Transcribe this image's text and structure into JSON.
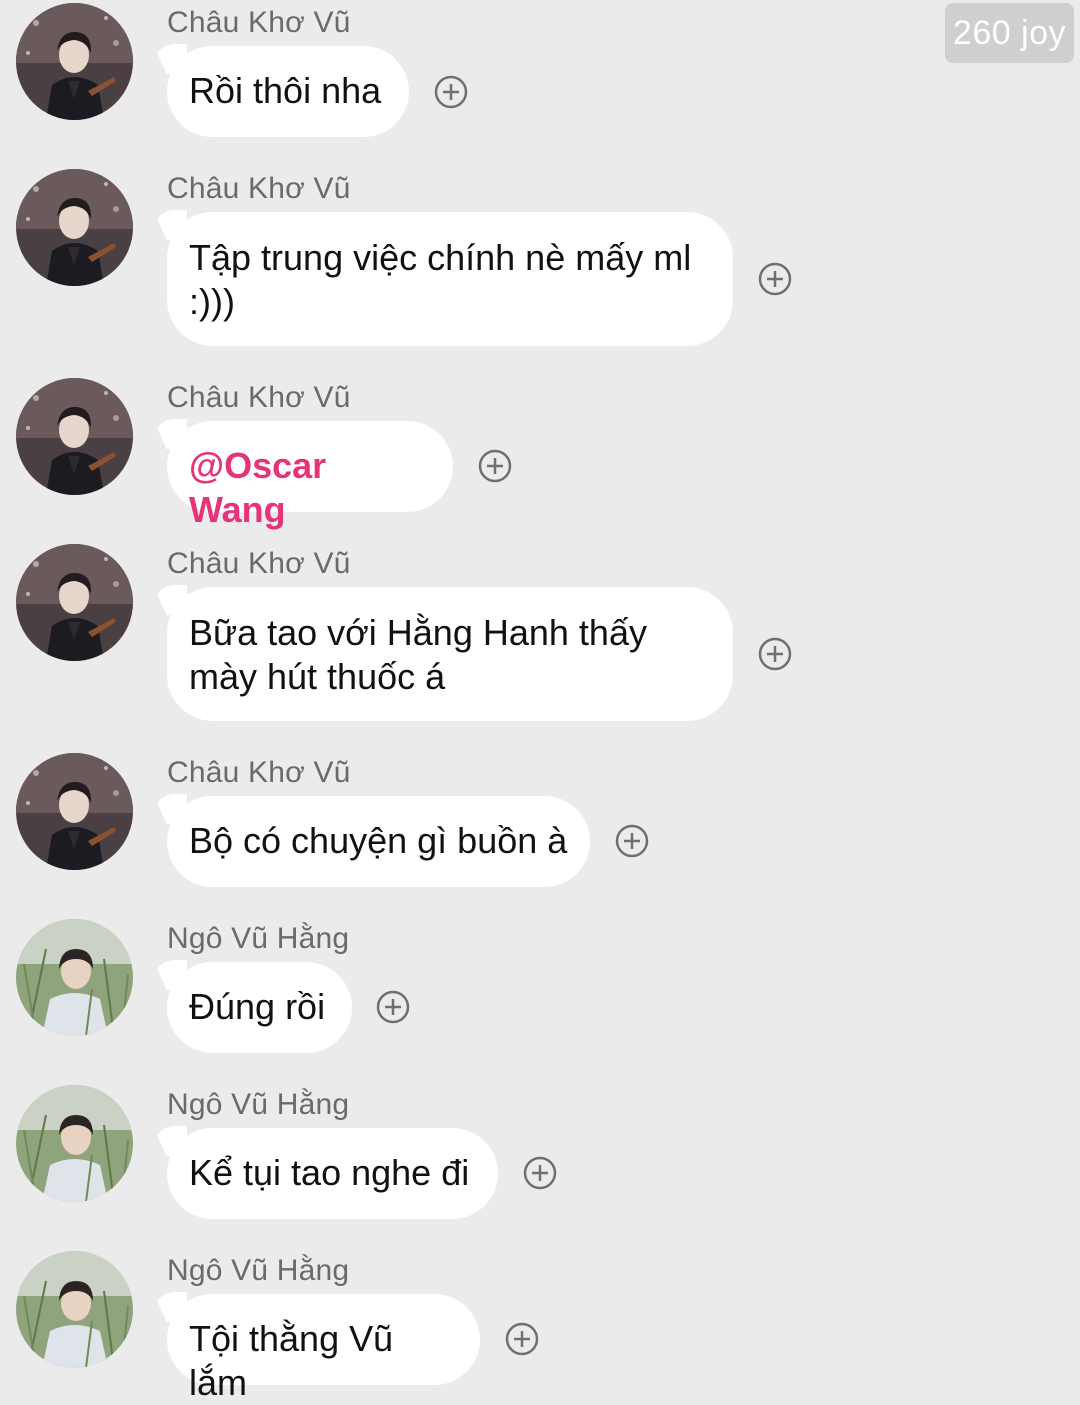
{
  "badge": {
    "label": "260 joy"
  },
  "messages": [
    {
      "sender": "Châu Khơ Vũ",
      "text": "Rồi thôi nha",
      "mention": false
    },
    {
      "sender": "Châu Khơ Vũ",
      "text": "Tập trung việc chính nè mấy ml :)))",
      "mention": false
    },
    {
      "sender": "Châu Khơ Vũ",
      "text": "@Oscar Wang",
      "mention": true
    },
    {
      "sender": "Châu Khơ Vũ",
      "text": "Bữa tao với Hằng Hanh thấy mày hút thuốc á",
      "mention": false
    },
    {
      "sender": "Châu Khơ Vũ",
      "text": "Bộ có chuyện gì buồn à",
      "mention": false
    },
    {
      "sender": "Ngô Vũ Hằng",
      "text": "Đúng rồi",
      "mention": false
    },
    {
      "sender": "Ngô Vũ Hằng",
      "text": "Kể tụi tao nghe đi",
      "mention": false
    },
    {
      "sender": "Ngô Vũ Hằng",
      "text": "Tội thằng Vũ lắm",
      "mention": false
    }
  ],
  "icons": {
    "react": "add-reaction-icon",
    "avatar_a": "avatar-photo-dark-stage",
    "avatar_b": "avatar-photo-outdoor-grass"
  },
  "colors": {
    "background": "#ebebeb",
    "bubble": "#ffffff",
    "mention": "#e7337a",
    "sender_name": "#6a6a6a",
    "badge_bg": "#cfcfcf"
  }
}
